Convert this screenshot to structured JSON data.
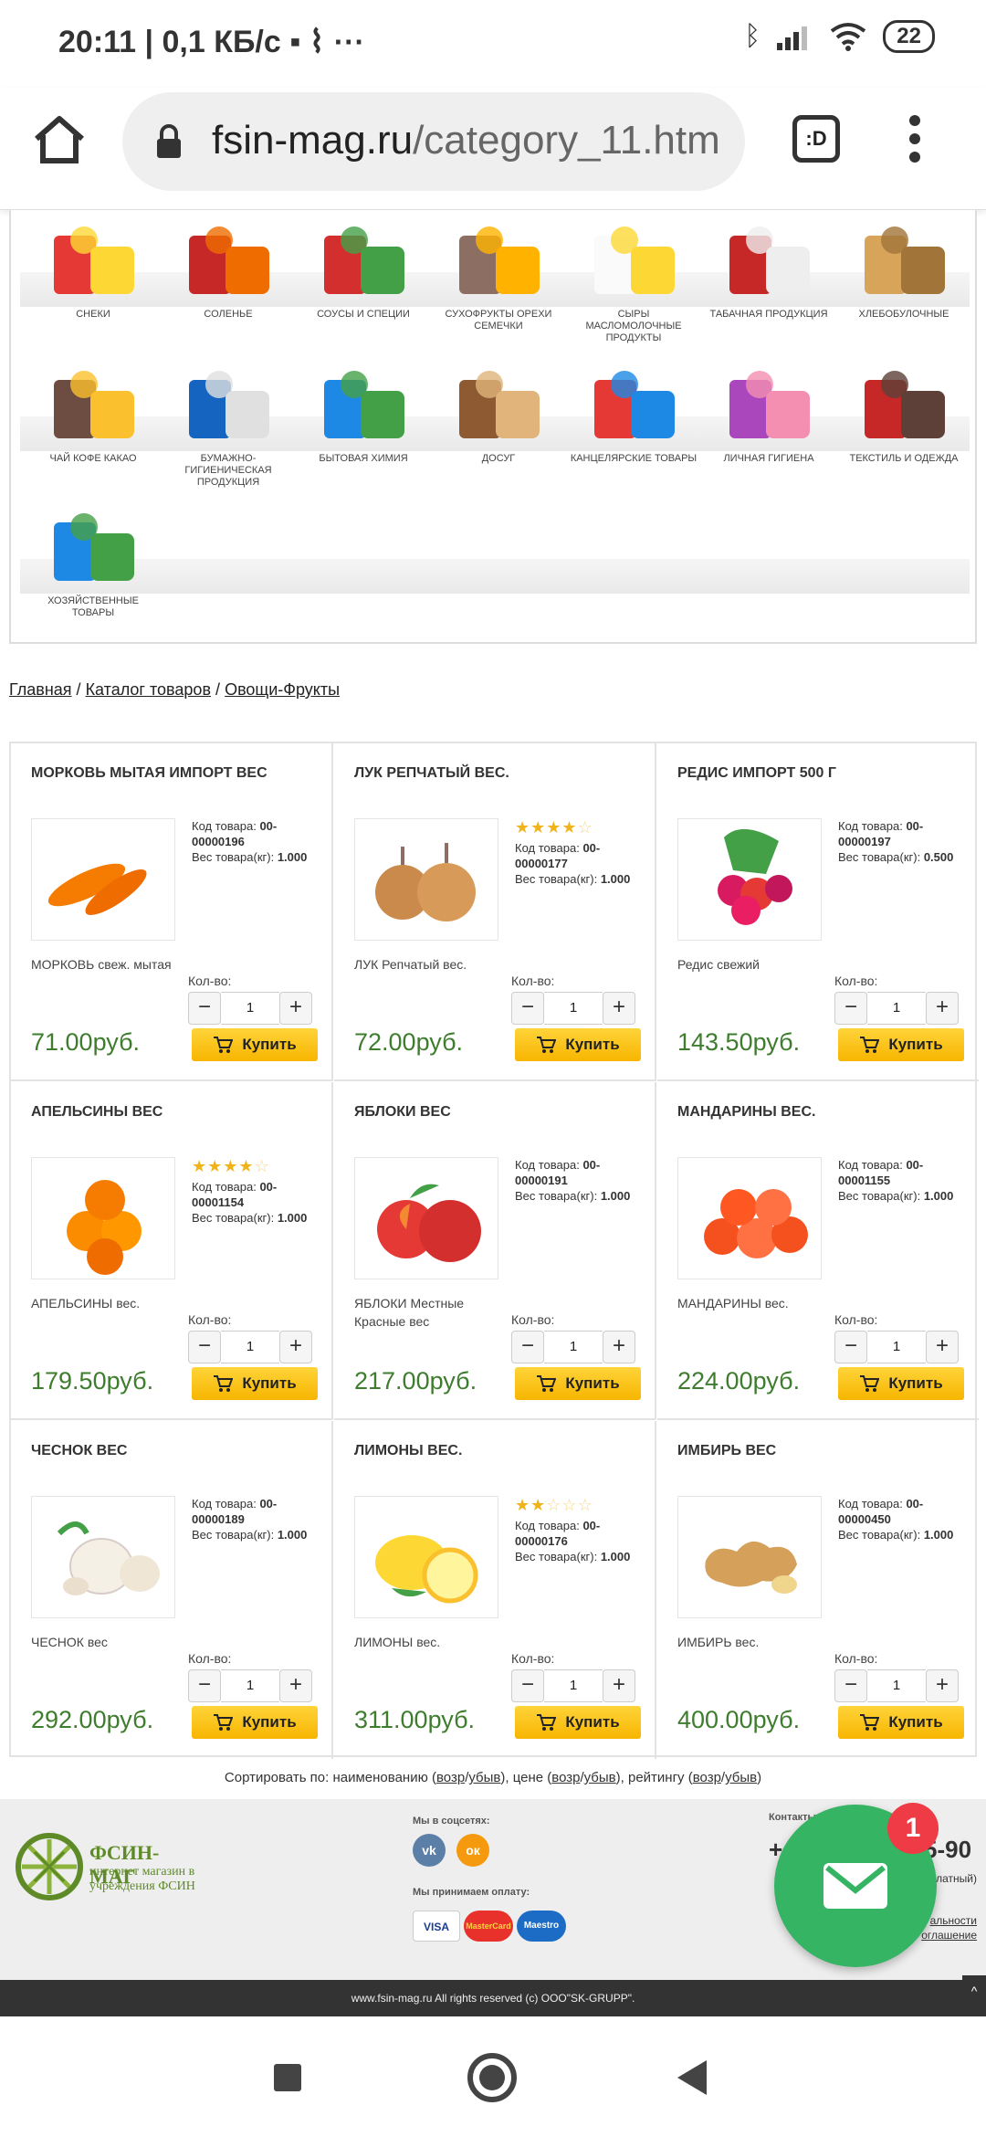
{
  "status_bar": {
    "time": "20:11",
    "net_speed": "0,1 КБ/с",
    "battery": "22"
  },
  "browser": {
    "url_domain": "fsin-mag.ru",
    "url_path": "/category_11.htm",
    "tabs_label": ":D"
  },
  "categories": [
    {
      "label": "СНЕКИ",
      "icon": "snacks-icon"
    },
    {
      "label": "СОЛЕНЬЕ",
      "icon": "pickles-icon"
    },
    {
      "label": "СОУСЫ И СПЕЦИИ",
      "icon": "sauces-icon"
    },
    {
      "label": "СУХОФРУКТЫ ОРЕХИ СЕМЕЧКИ",
      "icon": "dried-fruits-icon"
    },
    {
      "label": "СЫРЫ МАСЛОМОЛОЧНЫЕ ПРОДУКТЫ",
      "icon": "dairy-icon"
    },
    {
      "label": "ТАБАЧНАЯ ПРОДУКЦИЯ",
      "icon": "tobacco-icon"
    },
    {
      "label": "ХЛЕБОБУЛОЧНЫЕ",
      "icon": "bread-icon"
    },
    {
      "label": "ЧАЙ КОФЕ КАКАО",
      "icon": "tea-coffee-icon"
    },
    {
      "label": "БУМАЖНО-ГИГИЕНИЧЕСКАЯ ПРОДУКЦИЯ",
      "icon": "paper-hygiene-icon"
    },
    {
      "label": "БЫТОВАЯ ХИМИЯ",
      "icon": "household-chemicals-icon"
    },
    {
      "label": "ДОСУГ",
      "icon": "leisure-chess-icon"
    },
    {
      "label": "КАНЦЕЛЯРСКИЕ ТОВАРЫ",
      "icon": "stationery-icon"
    },
    {
      "label": "ЛИЧНАЯ ГИГИЕНА",
      "icon": "personal-hygiene-icon"
    },
    {
      "label": "ТЕКСТИЛЬ И ОДЕЖДА",
      "icon": "textile-icon"
    },
    {
      "label": "ХОЗЯЙСТВЕННЫЕ ТОВАРЫ",
      "icon": "household-goods-icon"
    }
  ],
  "breadcrumb": {
    "home": "Главная",
    "catalog": "Каталог товаров",
    "current": "Овощи-Фрукты",
    "sep": "/"
  },
  "labels": {
    "code": "Код товара:",
    "weight": "Вес товара(кг):",
    "qty": "Кол-во:",
    "buy": "Купить",
    "minus": "−",
    "plus": "+"
  },
  "products": [
    {
      "title": "МОРКОВЬ МЫТАЯ ИМПОРТ ВЕС",
      "subtitle": "МОРКОВЬ свеж. мытая",
      "code": "00-00000196",
      "weight": "1.000",
      "rating": null,
      "qty": "1",
      "price": "71.00руб.",
      "image": "carrot-image"
    },
    {
      "title": "ЛУК РЕПЧАТЫЙ ВЕС.",
      "subtitle": "ЛУК Репчатый вес.",
      "code": "00-00000177",
      "weight": "1.000",
      "rating": 4,
      "qty": "1",
      "price": "72.00руб.",
      "image": "onion-image"
    },
    {
      "title": "РЕДИС ИМПОРТ 500 Г",
      "subtitle": "Редис свежий",
      "code": "00-00000197",
      "weight": "0.500",
      "rating": null,
      "qty": "1",
      "price": "143.50руб.",
      "image": "radish-image"
    },
    {
      "title": "АПЕЛЬСИНЫ ВЕС",
      "subtitle": "АПЕЛЬСИНЫ вес.",
      "code": "00-00001154",
      "weight": "1.000",
      "rating": 4,
      "qty": "1",
      "price": "179.50руб.",
      "image": "orange-image"
    },
    {
      "title": "ЯБЛОКИ ВЕС",
      "subtitle": "ЯБЛОКИ Местные Красные вес",
      "code": "00-00000191",
      "weight": "1.000",
      "rating": null,
      "qty": "1",
      "price": "217.00руб.",
      "image": "apple-image"
    },
    {
      "title": "МАНДАРИНЫ ВЕС.",
      "subtitle": "МАНДАРИНЫ вес.",
      "code": "00-00001155",
      "weight": "1.000",
      "rating": null,
      "qty": "1",
      "price": "224.00руб.",
      "image": "tangerine-image"
    },
    {
      "title": "ЧЕСНОК ВЕС",
      "subtitle": "ЧЕСНОК вес",
      "code": "00-00000189",
      "weight": "1.000",
      "rating": null,
      "qty": "1",
      "price": "292.00руб.",
      "image": "garlic-image"
    },
    {
      "title": "ЛИМОНЫ ВЕС.",
      "subtitle": "ЛИМОНЫ вес.",
      "code": "00-00000176",
      "weight": "1.000",
      "rating": 2,
      "qty": "1",
      "price": "311.00руб.",
      "image": "lemon-image"
    },
    {
      "title": "ИМБИРЬ ВЕС",
      "subtitle": "ИМБИРЬ вес.",
      "code": "00-00000450",
      "weight": "1.000",
      "rating": null,
      "qty": "1",
      "price": "400.00руб.",
      "image": "ginger-image"
    }
  ],
  "sort": {
    "prefix": "Сортировать по: наименованию (",
    "name_asc": "возр",
    "name_desc": "убыв",
    "mid1": "), цене (",
    "price_asc": "возр",
    "price_desc": "убыв",
    "mid2": "), рейтингу (",
    "rating_asc": "возр",
    "rating_desc": "убыв",
    "suffix": ")",
    "slash": "/"
  },
  "footer": {
    "logo_title": "ФСИН-МАГ",
    "logo_subtitle": "интернет магазин в учреждения ФСИН",
    "social_label": "Мы в соцсетях:",
    "social_vk": "vk",
    "social_ok": "ок",
    "pay_label": "Мы принимаем оплату:",
    "pay_visa": "VISA",
    "pay_mastercard": "MasterCard",
    "pay_maestro": "Maestro",
    "contacts_label": "Контакты:",
    "phone_start": "+",
    "phone_end": "5-90",
    "phone_note": "платный)",
    "link_privacy": "альности",
    "link_agreement": "оглашение",
    "copyright": "www.fsin-mag.ru All rights reserved (c) ООО\"SK-GRUPP\".",
    "scroll_top": "^"
  },
  "chat": {
    "badge": "1"
  },
  "colors": {
    "price_green": "#3e7d2e",
    "buy_yellow": "#f7b500",
    "chat_green": "#35b463",
    "badge_red": "#ee3b46",
    "star": "#f0b41a"
  }
}
